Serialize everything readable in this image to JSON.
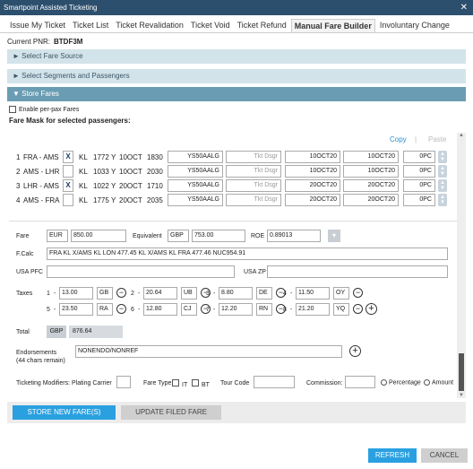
{
  "window": {
    "title": "Smartpoint Assisted Ticketing",
    "close": "✕"
  },
  "tabs": [
    {
      "label": "Issue My Ticket"
    },
    {
      "label": "Ticket List"
    },
    {
      "label": "Ticket Revalidation"
    },
    {
      "label": "Ticket Void"
    },
    {
      "label": "Ticket Refund"
    },
    {
      "label": "Manual Fare Builder"
    },
    {
      "label": "Involuntary Change"
    }
  ],
  "pnr": {
    "label": "Current PNR:",
    "value": "BTDF3M"
  },
  "sections": {
    "select_fare_source": "► Select Fare Source",
    "select_segments": "► Select Segments and Passengers",
    "store_fares": "▼ Store Fares"
  },
  "per_pax": {
    "label": "Enable per-pax Fares"
  },
  "fare_mask_title": "Fare Mask for selected passengers:",
  "copy_paste": {
    "copy": "Copy",
    "sep": "|",
    "paste": "Paste"
  },
  "segments": [
    {
      "num": "1",
      "route": "FRA - AMS",
      "x": "X",
      "carrier": "KL",
      "flight": "1772",
      "cls": "Y",
      "date": "10OCT",
      "time": "1830",
      "fare_basis": "YS50AALG",
      "designator": "Tkt Dsgr",
      "nvb": "10OCT20",
      "nva": "10OCT20",
      "bag": "0PC"
    },
    {
      "num": "2",
      "route": "AMS - LHR",
      "x": "",
      "carrier": "KL",
      "flight": "1033",
      "cls": "Y",
      "date": "10OCT",
      "time": "2030",
      "fare_basis": "YS50AALG",
      "designator": "Tkt Dsgr",
      "nvb": "10OCT20",
      "nva": "10OCT20",
      "bag": "0PC"
    },
    {
      "num": "3",
      "route": "LHR - AMS",
      "x": "X",
      "carrier": "KL",
      "flight": "1022",
      "cls": "Y",
      "date": "20OCT",
      "time": "1710",
      "fare_basis": "YS50AALG",
      "designator": "Tkt Dsgr",
      "nvb": "20OCT20",
      "nva": "20OCT20",
      "bag": "0PC"
    },
    {
      "num": "4",
      "route": "AMS - FRA",
      "x": "",
      "carrier": "KL",
      "flight": "1775",
      "cls": "Y",
      "date": "20OCT",
      "time": "2035",
      "fare_basis": "YS50AALG",
      "designator": "Tkt Dsgr",
      "nvb": "20OCT20",
      "nva": "20OCT20",
      "bag": "0PC"
    }
  ],
  "fare": {
    "label": "Fare",
    "currency": "EUR",
    "amount": "850.00",
    "equiv_label": "Equivalent",
    "equiv_currency": "GBP",
    "equiv_amount": "753.00",
    "roe_label": "ROE",
    "roe": "0.89013"
  },
  "fcalc": {
    "label": "F.Calc",
    "value": "FRA KL X/AMS KL LON 477.45 KL X/AMS KL FRA 477.46 NUC954.91"
  },
  "usa": {
    "pfc_label": "USA PFC",
    "zp_label": "USA ZP"
  },
  "taxes": {
    "label": "Taxes",
    "items": [
      {
        "n": "1",
        "amount": "13.00",
        "code": "GB"
      },
      {
        "n": "2",
        "amount": "20.64",
        "code": "UB"
      },
      {
        "n": "3",
        "amount": "8.80",
        "code": "DE"
      },
      {
        "n": "4",
        "amount": "11.50",
        "code": "OY"
      },
      {
        "n": "5",
        "amount": "23.50",
        "code": "RA"
      },
      {
        "n": "6",
        "amount": "12.80",
        "code": "CJ"
      },
      {
        "n": "7",
        "amount": "12.20",
        "code": "RN"
      },
      {
        "n": "8",
        "amount": "21.20",
        "code": "YQ"
      }
    ]
  },
  "total": {
    "label": "Total",
    "currency": "GBP",
    "amount": "876.64"
  },
  "endorsements": {
    "label": "Endorsements",
    "sub": "(44 chars remain)",
    "value": "NONENDO/NONREF"
  },
  "modifiers": {
    "label": "Ticketing Modifiers: Plating Carrier",
    "fare_type": "Fare Type",
    "it": "IT",
    "bt": "BT",
    "tour_code": "Tour Code",
    "commission": "Commission:",
    "percentage": "Percentage",
    "amount": "Amount"
  },
  "buttons": {
    "store": "STORE NEW FARE(S)",
    "update": "UPDATE FILED FARE",
    "refresh": "REFRESH",
    "cancel": "CANCEL"
  },
  "colors": {
    "titlebar": "#2d4f6e",
    "accent": "#2aa0e0",
    "section_active": "#6a9db3"
  }
}
